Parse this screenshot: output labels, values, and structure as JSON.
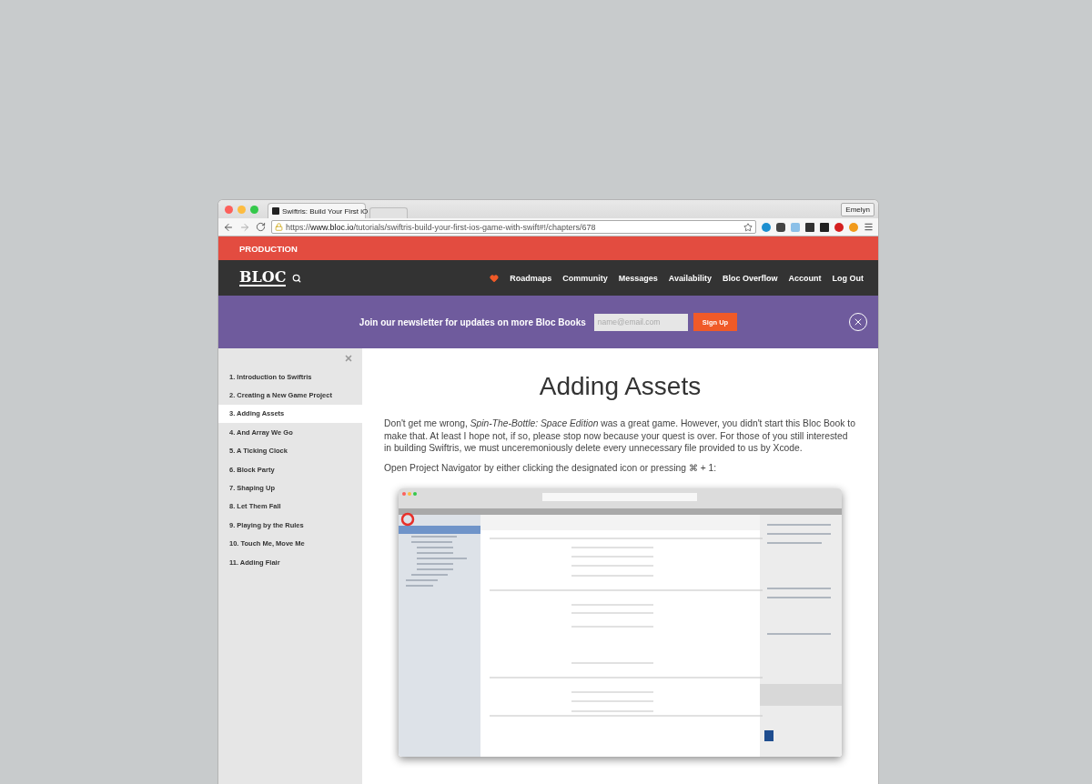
{
  "browser": {
    "tab_title": "Swiftris: Build Your First iO",
    "profile": "Emelyn",
    "url_scheme": "https://",
    "url_domain": "www.bloc.io",
    "url_path": "/tutorials/swiftris-build-your-first-ios-game-with-swift#!/chapters/678"
  },
  "env_banner": "PRODUCTION",
  "nav": {
    "logo": "BLOC",
    "links": [
      "Roadmaps",
      "Community",
      "Messages",
      "Availability",
      "Bloc Overflow",
      "Account",
      "Log Out"
    ]
  },
  "newsletter": {
    "text": "Join our newsletter for updates on more Bloc Books",
    "placeholder": "name@email.com",
    "button": "Sign Up"
  },
  "chapters": [
    {
      "label": "1. Introduction to Swiftris",
      "selected": false
    },
    {
      "label": "2. Creating a New Game Project",
      "selected": false
    },
    {
      "label": "3. Adding Assets",
      "selected": true
    },
    {
      "label": "4. And Array We Go",
      "selected": false
    },
    {
      "label": "5. A Ticking Clock",
      "selected": false
    },
    {
      "label": "6. Block Party",
      "selected": false
    },
    {
      "label": "7. Shaping Up",
      "selected": false
    },
    {
      "label": "8. Let Them Fall",
      "selected": false
    },
    {
      "label": "9. Playing by the Rules",
      "selected": false
    },
    {
      "label": "10. Touch Me, Move Me",
      "selected": false
    },
    {
      "label": "11. Adding Flair",
      "selected": false
    }
  ],
  "article": {
    "title": "Adding Assets",
    "paragraphs": [
      "Don't get me wrong, *Spin-The-Bottle: Space Edition* was a great game. However, you didn't start this Bloc Book to make that. At least I hope not, if so, please stop now because your quest is over. For those of you still interested in building Swiftris, we must unceremoniously delete every unnecessary file provided to us by Xcode.",
      "Open Project Navigator by either clicking the designated icon or pressing ⌘ + 1:"
    ]
  }
}
